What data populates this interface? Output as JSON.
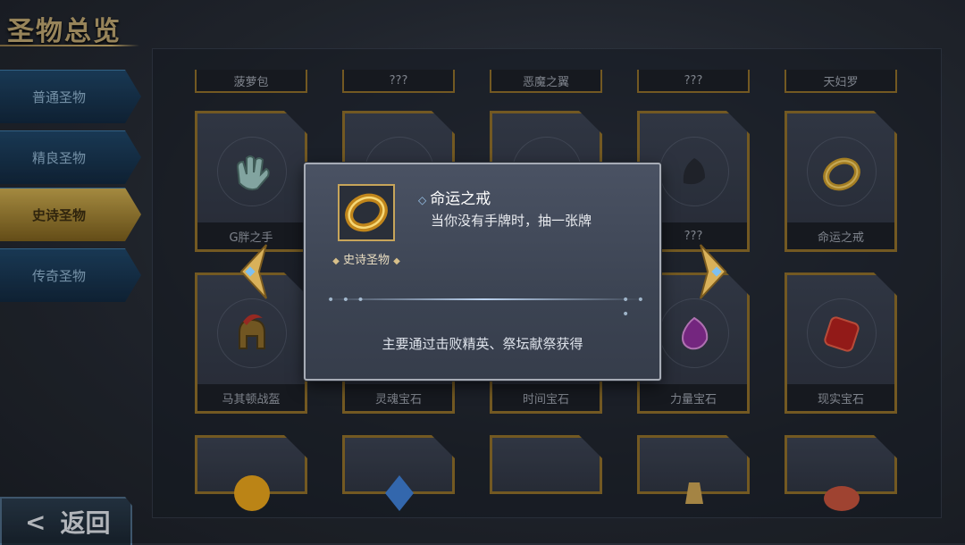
{
  "screen": {
    "title": "圣物总览",
    "back_label": "返回",
    "back_glyph": "<"
  },
  "sidebar": {
    "tabs": [
      {
        "label": "普通圣物",
        "active": false
      },
      {
        "label": "精良圣物",
        "active": false
      },
      {
        "label": "史诗圣物",
        "active": true
      },
      {
        "label": "传奇圣物",
        "active": false
      }
    ]
  },
  "grid": {
    "top_row_names": [
      "菠萝包",
      "???",
      "恶魔之翼",
      "???",
      "天妇罗"
    ],
    "row1": [
      {
        "name": "G胖之手",
        "icon": "glove-icon"
      },
      {
        "name": "",
        "icon": "hidden"
      },
      {
        "name": "",
        "icon": "hidden"
      },
      {
        "name": "???",
        "icon": "unknown-silhouette-icon"
      },
      {
        "name": "命运之戒",
        "icon": "ring-icon"
      }
    ],
    "row2": [
      {
        "name": "马其顿战盔",
        "icon": "spartan-helmet-icon"
      },
      {
        "name": "灵魂宝石",
        "icon": "hidden"
      },
      {
        "name": "时间宝石",
        "icon": "hidden"
      },
      {
        "name": "力量宝石",
        "icon": "purple-gem-icon"
      },
      {
        "name": "现实宝石",
        "icon": "red-gem-icon"
      }
    ],
    "row3_icons": [
      "orange-orb-icon",
      "blue-gem-icon",
      "dark-item-icon",
      "gold-bottle-icon",
      "red-plate-icon"
    ]
  },
  "modal": {
    "relic_icon": "gold-ring-icon",
    "rarity": "史诗圣物",
    "name": "命运之戒",
    "description": "当你没有手牌时，抽一张牌",
    "obtain": "主要通过击败精英、祭坛献祭获得",
    "dots": "• • •"
  },
  "colors": {
    "card_border": "#8d6d2a",
    "active_tab": "#c8a84e",
    "tab_blue": "#1f4566",
    "modal_border": "#a7acb6",
    "name_diamond": "#9cc7ee"
  }
}
